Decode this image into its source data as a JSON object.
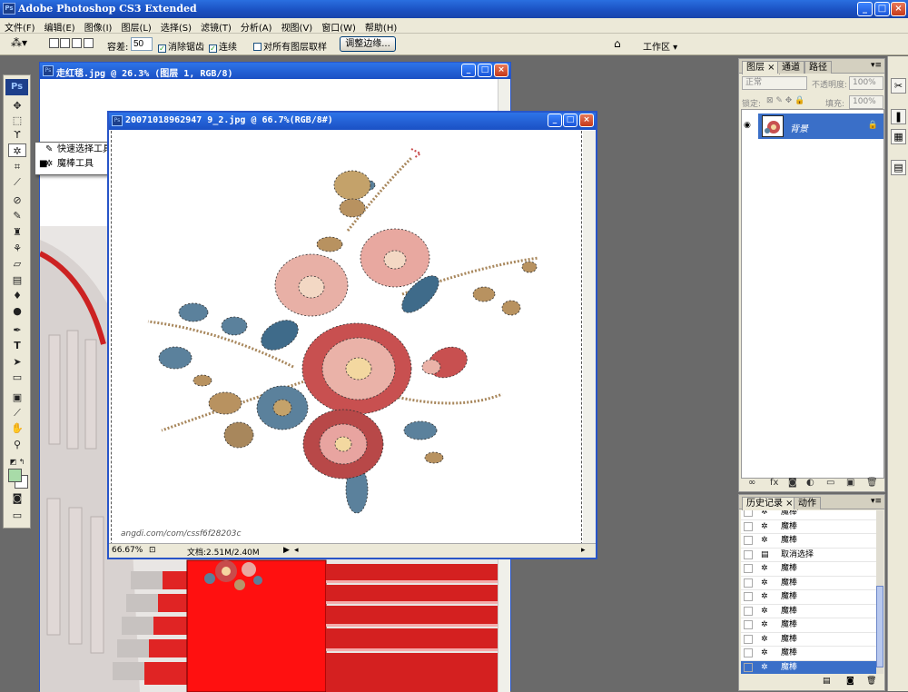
{
  "app": {
    "title": "Adobe Photoshop CS3 Extended",
    "logo": "Ps"
  },
  "menu": [
    "文件(F)",
    "编辑(E)",
    "图像(I)",
    "图层(L)",
    "选择(S)",
    "滤镜(T)",
    "分析(A)",
    "视图(V)",
    "窗口(W)",
    "帮助(H)"
  ],
  "options": {
    "tolerance_label": "容差:",
    "tolerance_value": "50",
    "antialias_label": "消除锯齿",
    "antialias_checked": true,
    "contiguous_label": "连续",
    "contiguous_checked": true,
    "sample_all_label": "对所有图层取样",
    "sample_all_checked": false,
    "refine_edge_label": "调整边缘...",
    "workspace_label": "工作区"
  },
  "flyout": {
    "items": [
      {
        "label": "快速选择工具",
        "key": "W",
        "selected": false
      },
      {
        "label": "魔棒工具",
        "key": "W",
        "selected": true
      }
    ]
  },
  "doc1": {
    "title": "走红毯.jpg @ 26.3% (图层 1, RGB/8)"
  },
  "doc2": {
    "title": "20071018962947 9_2.jpg @ 66.7%(RGB/8#)",
    "zoom": "66.67%",
    "doc_info": "文档:2.51M/2.40M",
    "watermark": "angdi.com/com/cssf6f28203c"
  },
  "layers_panel": {
    "tabs": [
      "图层",
      "通道",
      "路径"
    ],
    "blend_mode": "正常",
    "opacity_label": "不透明度:",
    "opacity_value": "100%",
    "lock_label": "锁定:",
    "fill_label": "填充:",
    "fill_value": "100%",
    "layer_name": "背景"
  },
  "history_panel": {
    "tabs": [
      "历史记录",
      "动作"
    ],
    "items": [
      {
        "label": "魔棒",
        "selected": false
      },
      {
        "label": "魔棒",
        "selected": false
      },
      {
        "label": "魔棒",
        "selected": false
      },
      {
        "label": "取消选择",
        "selected": false
      },
      {
        "label": "魔棒",
        "selected": false
      },
      {
        "label": "魔棒",
        "selected": false
      },
      {
        "label": "魔棒",
        "selected": false
      },
      {
        "label": "魔棒",
        "selected": false
      },
      {
        "label": "魔棒",
        "selected": false
      },
      {
        "label": "魔棒",
        "selected": false
      },
      {
        "label": "魔棒",
        "selected": false
      },
      {
        "label": "魔棒",
        "selected": true
      }
    ]
  },
  "colors": {
    "accent": "#3a6fc8",
    "title_bar": "#1a50c4",
    "carpet": "#ff1010",
    "foreground": "#a8dba8"
  }
}
